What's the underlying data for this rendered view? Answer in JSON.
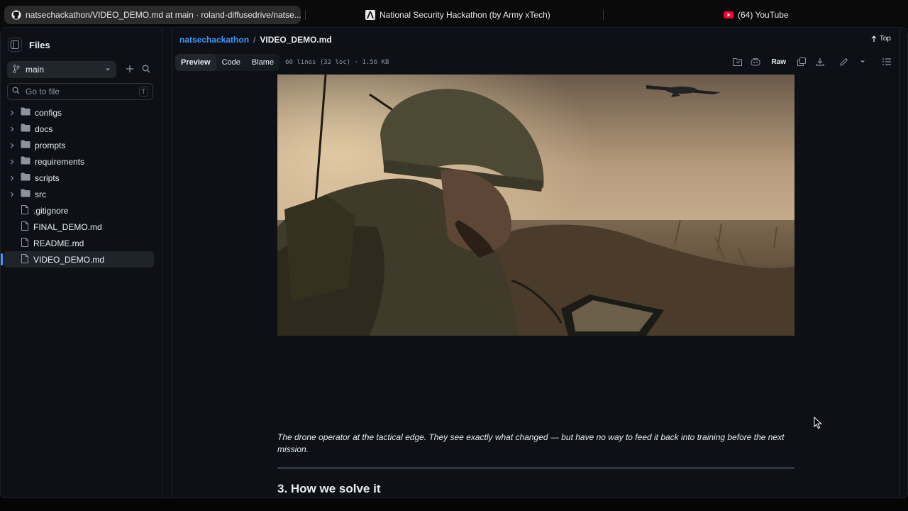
{
  "browser": {
    "tabs": [
      {
        "title": "natsechackathon/VIDEO_DEMO.md at main · roland-diffusedrive/natse...",
        "icon": "github-icon",
        "active": true
      },
      {
        "title": "National Security Hackathon (by Army xTech)",
        "icon": "army-xtech-icon",
        "active": false
      },
      {
        "title": "(64) YouTube",
        "icon": "youtube-icon",
        "active": false
      }
    ]
  },
  "sidebar": {
    "title": "Files",
    "branch": "main",
    "goto_placeholder": "Go to file",
    "goto_shortcut": "T",
    "items": [
      {
        "label": "configs",
        "type": "folder"
      },
      {
        "label": "docs",
        "type": "folder"
      },
      {
        "label": "prompts",
        "type": "folder"
      },
      {
        "label": "requirements",
        "type": "folder"
      },
      {
        "label": "scripts",
        "type": "folder"
      },
      {
        "label": "src",
        "type": "folder"
      },
      {
        "label": ".gitignore",
        "type": "file"
      },
      {
        "label": "FINAL_DEMO.md",
        "type": "file"
      },
      {
        "label": "README.md",
        "type": "file"
      },
      {
        "label": "VIDEO_DEMO.md",
        "type": "file",
        "selected": true
      }
    ]
  },
  "main": {
    "breadcrumb": {
      "repo": "natsechackathon",
      "separator": "/",
      "file": "VIDEO_DEMO.md"
    },
    "top_label": "Top",
    "tabs": [
      "Preview",
      "Code",
      "Blame"
    ],
    "active_tab": "Preview",
    "file_meta": "60 lines (32 loc) · 1.56 KB",
    "raw_label": "Raw",
    "caption": "The drone operator at the tactical edge. They see exactly what changed — but have no way to feed it back into training before the next mission.",
    "section_heading": "3. How we solve it"
  },
  "colors": {
    "background": "#0d1117",
    "link": "#4493f8",
    "text": "#e6edf3",
    "muted": "#8b949e"
  }
}
